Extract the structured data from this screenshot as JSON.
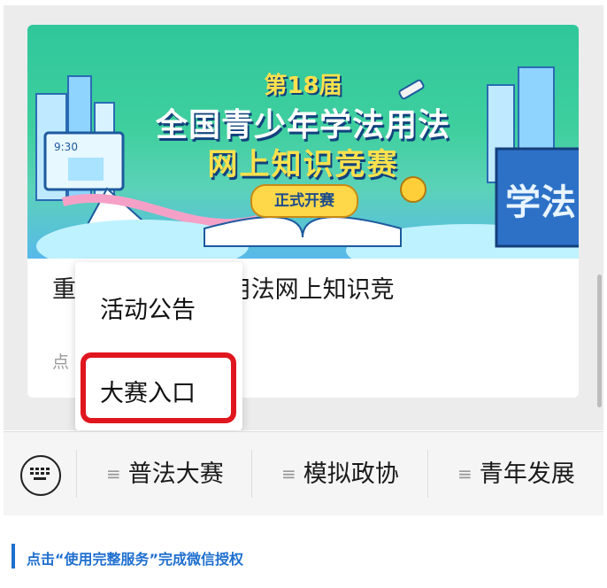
{
  "banner": {
    "edition": "第18届",
    "title": "全国青少年学法用法",
    "subtitle": "网上知识竞赛",
    "pill": "正式开赛",
    "side_word": "学法"
  },
  "article": {
    "title": "重 国青少年学法用法网上知识竞",
    "subtitle_fragment": "点"
  },
  "popup": {
    "items": [
      {
        "label": "活动公告"
      },
      {
        "label": "大赛入口",
        "highlighted": true
      }
    ],
    "highlight_color": "#e0161f"
  },
  "menu": {
    "keyboard_icon": "keyboard-icon",
    "items": [
      {
        "label": "普法大赛"
      },
      {
        "label": "模拟政协"
      },
      {
        "label": "青年发展"
      }
    ],
    "item_icon": "menu-lines-icon"
  },
  "footer": {
    "text": "点击“使用完整服务”完成微信授权",
    "accent": "#1f6fcf"
  }
}
